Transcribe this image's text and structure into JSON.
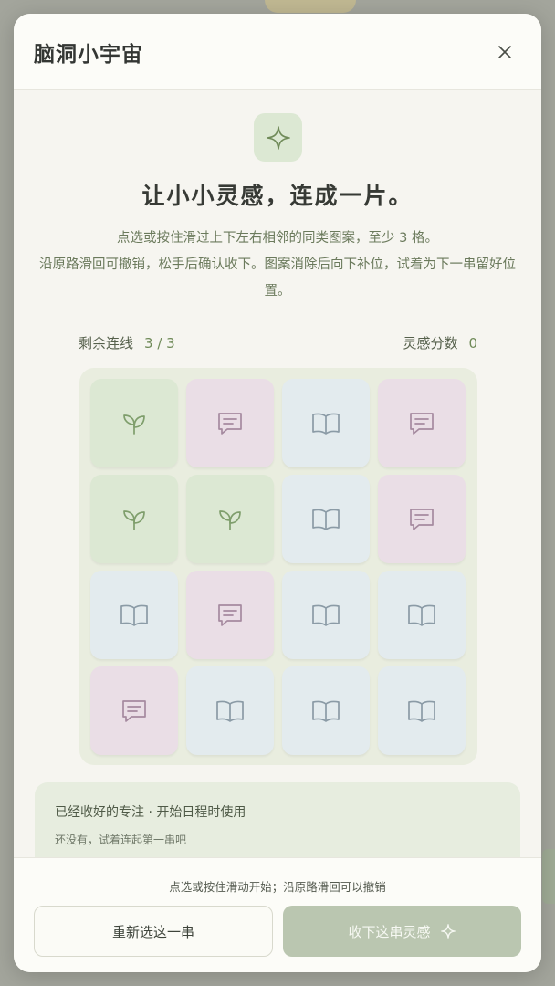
{
  "app": {
    "title": "脑洞小宇宙"
  },
  "intro": {
    "headline": "让小小灵感，连成一片。",
    "desc_line1": "点选或按住滑过上下左右相邻的同类图案，至少 3 格。",
    "desc_line2": "沿原路滑回可撤销，松手后确认收下。图案消除后向下补位，试着为下一串留好位置。"
  },
  "stats": {
    "links_label": "剩余连线",
    "links_value": "3 / 3",
    "score_label": "灵感分数",
    "score_value": "0"
  },
  "board": {
    "rows": 4,
    "cols": 4,
    "tiles": [
      "leaf",
      "chat",
      "book",
      "chat",
      "leaf",
      "leaf",
      "book",
      "chat",
      "book",
      "chat",
      "book",
      "book",
      "chat",
      "book",
      "book",
      "book"
    ],
    "icons": {
      "leaf": "sprout-icon",
      "chat": "chat-bubble-icon",
      "book": "open-book-icon"
    }
  },
  "collected": {
    "title": "已经收好的专注 · 开始日程时使用",
    "empty": "还没有，试着连起第一串吧"
  },
  "footer": {
    "hint": "点选或按住滑动开始；沿原路滑回可以撤销",
    "reset_label": "重新选这一串",
    "collect_label": "收下这串灵感"
  },
  "colors": {
    "leaf_tile": "#dce8d3",
    "chat_tile": "#eadee6",
    "book_tile": "#e3ebee",
    "leaf_icon": "#7f9e6c",
    "chat_icon": "#a58a9f",
    "book_icon": "#8b9ba6",
    "accent": "#6f8a58"
  }
}
